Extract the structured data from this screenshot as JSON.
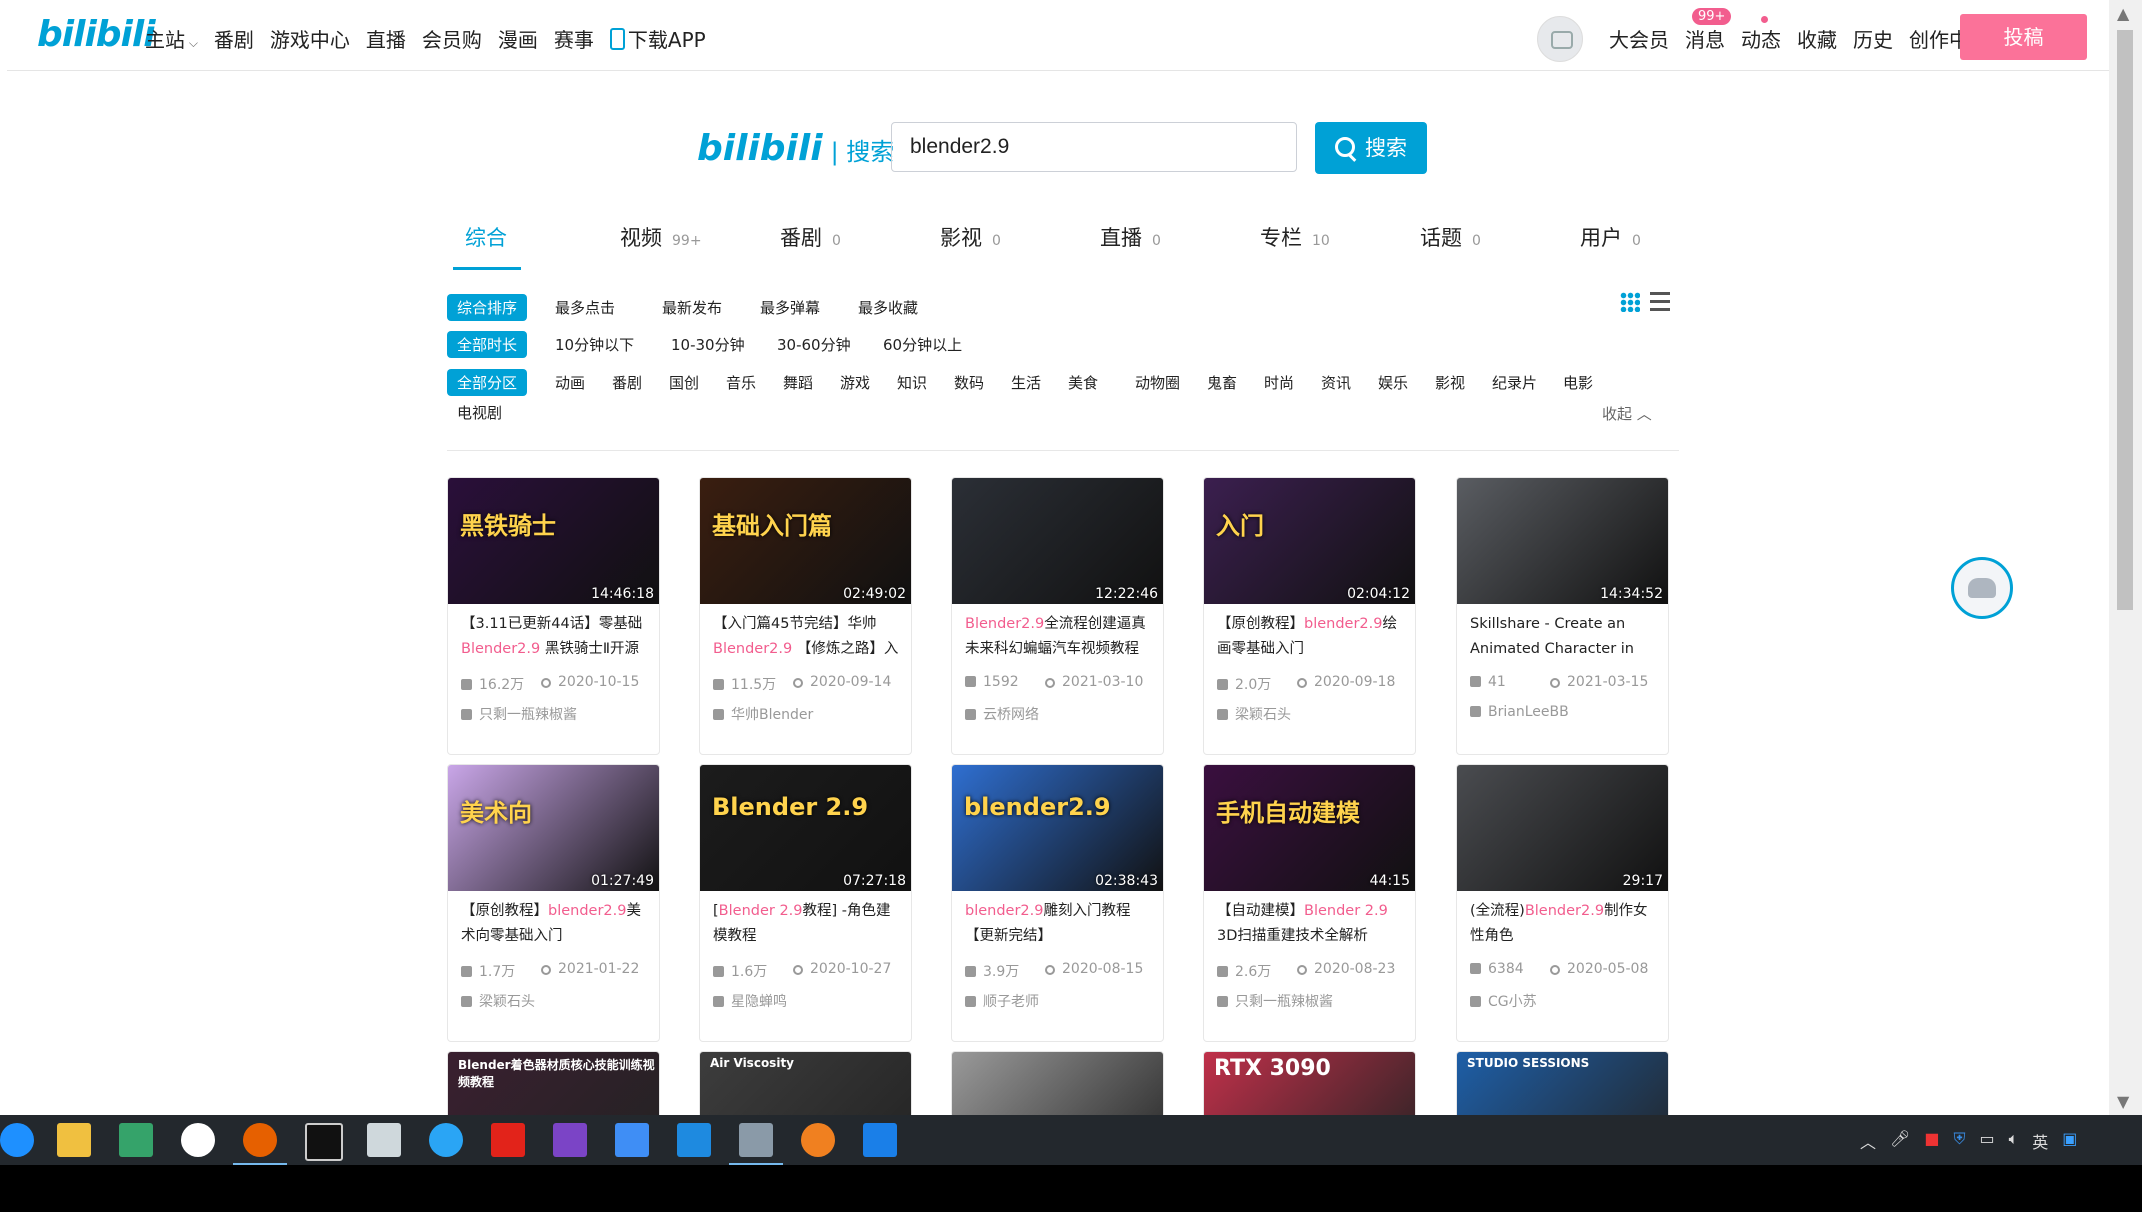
{
  "header": {
    "logo": "bilibili",
    "nav": [
      "主站",
      "番剧",
      "游戏中心",
      "直播",
      "会员购",
      "漫画",
      "赛事",
      "下载APP"
    ],
    "badge": "99+",
    "links": [
      "大会员",
      "消息",
      "动态",
      "收藏",
      "历史",
      "创作中心"
    ],
    "upload": "投稿"
  },
  "search": {
    "logo": "bilibili",
    "logo_suffix": "| 搜索",
    "query": "blender2.9",
    "button": "搜索"
  },
  "tabs": [
    {
      "label": "综合",
      "count": ""
    },
    {
      "label": "视频",
      "count": "99+"
    },
    {
      "label": "番剧",
      "count": "0"
    },
    {
      "label": "影视",
      "count": "0"
    },
    {
      "label": "直播",
      "count": "0"
    },
    {
      "label": "专栏",
      "count": "10"
    },
    {
      "label": "话题",
      "count": "0"
    },
    {
      "label": "用户",
      "count": "0"
    }
  ],
  "filters": {
    "order": [
      "综合排序",
      "最多点击",
      "最新发布",
      "最多弹幕",
      "最多收藏"
    ],
    "duration": [
      "全部时长",
      "10分钟以下",
      "10-30分钟",
      "30-60分钟",
      "60分钟以上"
    ],
    "zone": [
      "全部分区",
      "动画",
      "番剧",
      "国创",
      "音乐",
      "舞蹈",
      "游戏",
      "知识",
      "数码",
      "生活",
      "美食",
      "动物圈",
      "鬼畜",
      "时尚",
      "资讯",
      "娱乐",
      "影视",
      "纪录片",
      "电影",
      "电视剧"
    ],
    "collapse": "收起"
  },
  "videos": [
    {
      "pre": "【3.11已更新44话】零基础",
      "hl": "Blender2.9",
      "post": " 黑铁骑士Ⅱ开源",
      "views": "16.2万",
      "date": "2020-10-15",
      "up": "只剩一瓶辣椒酱",
      "duration": "14:46:18",
      "cover_text": "黑铁骑士",
      "cover_bg": "#2a0f3a"
    },
    {
      "pre": "【入门篇45节完结】华帅",
      "hl": "Blender2.9",
      "post": " 【修炼之路】入",
      "views": "11.5万",
      "date": "2020-09-14",
      "up": "华帅Blender",
      "duration": "02:49:02",
      "cover_text": "基础入门篇",
      "cover_bg": "#3a1e10"
    },
    {
      "pre": "",
      "hl": "Blender2.9",
      "post": "全流程创建逼真未来科幻蝙蝠汽车视频教程",
      "views": "1592",
      "date": "2021-03-10",
      "up": "云桥网络",
      "duration": "12:22:46",
      "cover_text": "",
      "cover_bg": "#2b2f36"
    },
    {
      "pre": "【原创教程】",
      "hl": "blender2.9",
      "post": "绘画零基础入门",
      "views": "2.0万",
      "date": "2020-09-18",
      "up": "梁颖石头",
      "duration": "02:04:12",
      "cover_text": "入门",
      "cover_bg": "#3b1f4f"
    },
    {
      "pre": "Skillshare - Create an Animated Character in",
      "hl": "",
      "post": "",
      "views": "41",
      "date": "2021-03-15",
      "up": "BrianLeeBB",
      "duration": "14:34:52",
      "cover_text": "",
      "cover_bg": "#5a5d62"
    },
    {
      "pre": "【原创教程】",
      "hl": "blender2.9",
      "post": "美术向零基础入门",
      "views": "1.7万",
      "date": "2021-01-22",
      "up": "梁颖石头",
      "duration": "01:27:49",
      "cover_text": "美术向",
      "cover_bg": "#c9a6e8"
    },
    {
      "pre": "[",
      "hl": "Blender 2.9",
      "post": "教程] -角色建模教程",
      "views": "1.6万",
      "date": "2020-10-27",
      "up": "星隐蝉鸣",
      "duration": "07:27:18",
      "cover_text": "Blender 2.9",
      "cover_bg": "#1c1c1c"
    },
    {
      "pre": "",
      "hl": "blender2.9",
      "post": "雕刻入门教程 【更新完结】",
      "views": "3.9万",
      "date": "2020-08-15",
      "up": "顺子老师",
      "duration": "02:38:43",
      "cover_text": "blender2.9",
      "cover_bg": "#2f6fd1"
    },
    {
      "pre": "【自动建模】",
      "hl": "Blender 2.9",
      "post": " 3D扫描重建技术全解析",
      "views": "2.6万",
      "date": "2020-08-23",
      "up": "只剩一瓶辣椒酱",
      "duration": "44:15",
      "cover_text": "手机自动建模",
      "cover_bg": "#3a0f3f"
    },
    {
      "pre": "(全流程)",
      "hl": "Blender2.9",
      "post": "制作女性角色",
      "views": "6384",
      "date": "2020-05-08",
      "up": "CG小苏",
      "duration": "29:17",
      "cover_text": "",
      "cover_bg": "#4a4c50"
    }
  ],
  "row3_covers": [
    {
      "text": "Blender着色器材质核心技能训练视频教程",
      "bg": "#3a2030"
    },
    {
      "text": "Air Viscosity",
      "bg": "#3d3d3d"
    },
    {
      "text": "",
      "bg": "#9a9a9a"
    },
    {
      "text": "RTX 3090",
      "bg": "#c0304a"
    },
    {
      "text": "STUDIO SESSIONS",
      "bg": "#1e5fa8"
    }
  ],
  "taskbar": {
    "tray_lang": "英"
  }
}
